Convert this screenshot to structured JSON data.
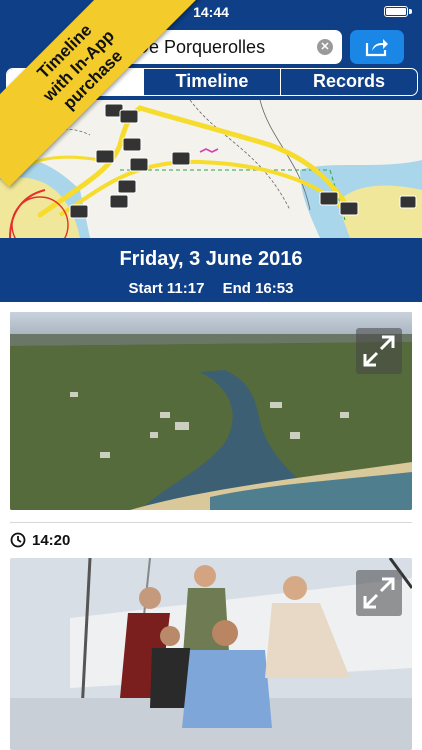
{
  "status_bar": {
    "time": "14:44"
  },
  "search": {
    "value": "De Porquerolles"
  },
  "tabs": [
    "…y",
    "Timeline",
    "Records"
  ],
  "banner": {
    "lines": [
      "Timeline",
      "with In-App",
      "purchase"
    ]
  },
  "trip": {
    "date": "Friday, 3 June 2016",
    "start": "Start 11:17",
    "end": "End 16:53"
  },
  "entry": {
    "time": "14:20"
  },
  "colors": {
    "navy": "#0f3f86",
    "blue_button": "#1a86e6",
    "banner_yellow": "#f3cc2b",
    "track_yellow": "#f6dc2c"
  }
}
